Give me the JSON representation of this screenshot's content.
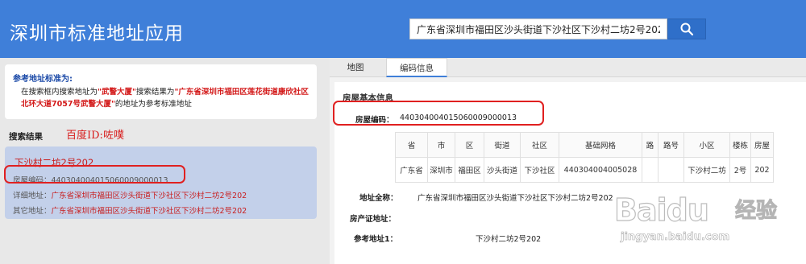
{
  "header": {
    "title": "深圳市标准地址应用",
    "search_value": "广东省深圳市福田区沙头街道下沙社区下沙村二坊2号202",
    "search_button_icon": "search-icon",
    "bg_color": "#3f7fd9"
  },
  "note": {
    "title": "参考地址标准为:",
    "line_pre": "在搜索框内搜索地址为",
    "q1": "\"武警大厦\"",
    "line_mid": "搜索结果为",
    "q2": "\"广东省深圳市福田区莲花街道康欣社区北环大道7057号武警大厦\"",
    "line_post": "的地址为参考标准地址"
  },
  "results": {
    "label": "搜索结果",
    "overlay_note": "百度ID:咗噗",
    "item": {
      "title": "下沙村二坊2号202",
      "code_label": "房屋编码：",
      "code_value": "440304004015060009000013",
      "detail_label": "详细地址：",
      "detail_value": "广东省深圳市福田区沙头街道下沙社区下沙村二坊2号202",
      "other_label": "其它地址：",
      "other_value": "广东省深圳市福田区沙头街道下沙社区下沙村二坊2号202"
    }
  },
  "tabs": [
    {
      "label": "地图",
      "active": false
    },
    {
      "label": "编码信息",
      "active": true
    }
  ],
  "basic_info": {
    "section_title": "房屋基本信息",
    "code_label": "房屋编码：",
    "code_value": "440304004015060009000013",
    "table": {
      "headers": [
        "省",
        "市",
        "区",
        "街道",
        "社区",
        "基础网格",
        "路",
        "路号",
        "小区",
        "楼栋",
        "房屋"
      ],
      "row": [
        "广东省",
        "深圳市",
        "福田区",
        "沙头街道",
        "下沙社区",
        "440304004005028",
        "",
        "",
        "下沙村二坊",
        "2号",
        "202"
      ]
    },
    "full_addr_label": "地址全称：",
    "full_addr_value": "广东省深圳市福田区沙头街道下沙社区下沙村二坊2号202",
    "deed_addr_label": "房产证地址：",
    "deed_addr_value": "",
    "ref_addr_label": "参考地址1：",
    "ref_addr_value": "下沙村二坊2号202"
  },
  "watermark": {
    "logo_text": "Baidu",
    "jy_text": "经验",
    "url": "jingyan.baidu.com"
  }
}
